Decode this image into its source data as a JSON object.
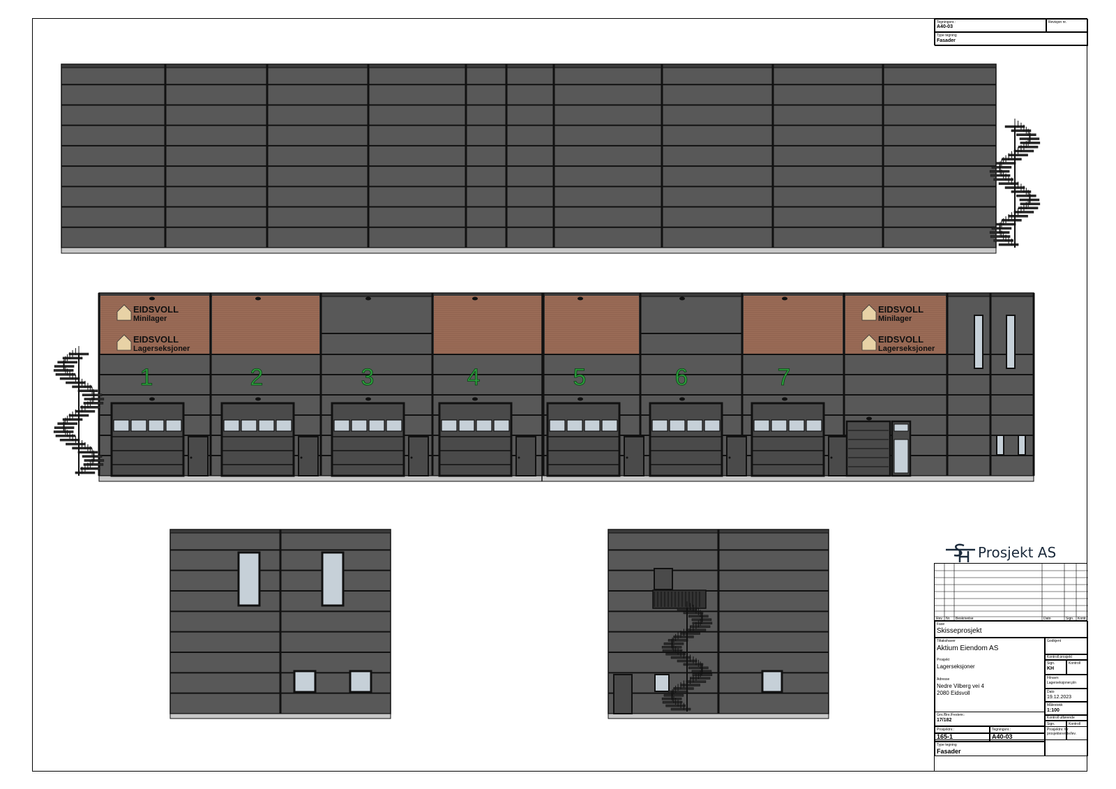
{
  "titleblock_top": {
    "drawing_no_label": "Tegningsnr.:",
    "drawing_no": "A40-03",
    "revision_label": "Revisjon nr.",
    "type_label": "Type tegning",
    "type": "Fasader"
  },
  "logo": {
    "symbol": "SH",
    "text": "Prosjekt AS"
  },
  "revision_table": {
    "headers": [
      "Rev",
      "Nr.",
      "Beskrivelse",
      "Dato",
      "Sign.",
      "Kontr."
    ]
  },
  "titleblock": {
    "fase_label": "Fase",
    "fase": "Skisseprosjekt",
    "owner_label": "Tiltakshaver",
    "owner": "Aktium Eiendom AS",
    "approved_label": "Godkjent",
    "project_label": "Prosjekt",
    "project": "Lagerseksjoner",
    "control_project_label": "Kontroll prosjekt",
    "sign_label": "Sign.",
    "sign": "KH",
    "kontroll_label": "Kontroll",
    "address_label": "Adresse",
    "address_line1": "Nedre Vilberg vei 4",
    "address_line2": "2080 Eidsvoll",
    "filename_label": "Filnavn:",
    "filename": "Lagerseksjoner.pln",
    "date_label": "Dato",
    "date": "19.12.2023",
    "scale_label": "Målestokk",
    "scale": "1:100",
    "control_exec_label": "Kontroll utførende",
    "sign2_label": "Sign.",
    "kontroll2_label": "Kontroll",
    "gnr_label": "Gnr./Bnr./Festenr.:",
    "gnr": "17/182",
    "projnr_label": "Prosjektnr.:",
    "projnr": "165-1",
    "drawno_label": "Tegningsnr.:",
    "drawno": "A40-03",
    "projnr_note_label": "Prosjektnr. for prosjekterende/lev.",
    "type_label": "Type tegning",
    "type": "Fasader"
  },
  "facade": {
    "unit_numbers": [
      "1",
      "2",
      "3",
      "4",
      "5",
      "6",
      "7"
    ],
    "signs": [
      {
        "brand": "EIDSVOLL",
        "sub": "Minilager"
      },
      {
        "brand": "EIDSVOLL",
        "sub": "Lagerseksjoner"
      }
    ]
  },
  "colors": {
    "wall": "#585858",
    "line": "#111111",
    "wood": "#9c6d58",
    "glass": "#c6d0d8",
    "number": "#2c9e3c",
    "sign_icon": "#e8d2a6",
    "plinth": "#c8c8c8"
  }
}
